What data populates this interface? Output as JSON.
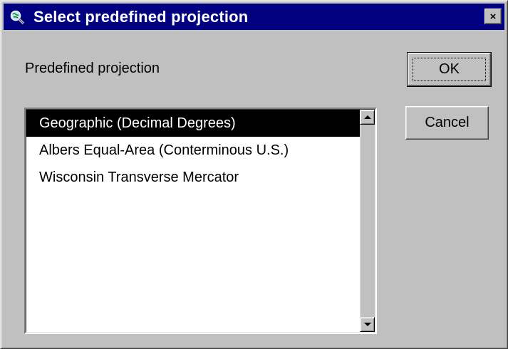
{
  "window": {
    "title": "Select predefined projection",
    "app_icon": "globe-magnifier-icon",
    "close_glyph": "×"
  },
  "form": {
    "label": "Predefined projection",
    "projections": [
      {
        "label": "Geographic (Decimal Degrees)",
        "selected": true
      },
      {
        "label": "Albers Equal-Area (Conterminous U.S.)",
        "selected": false
      },
      {
        "label": "Wisconsin Transverse Mercator",
        "selected": false
      }
    ]
  },
  "buttons": {
    "ok_label": "OK",
    "cancel_label": "Cancel"
  },
  "colors": {
    "titlebar": "#000080",
    "face": "#c0c0c0",
    "selection": "#000000"
  }
}
